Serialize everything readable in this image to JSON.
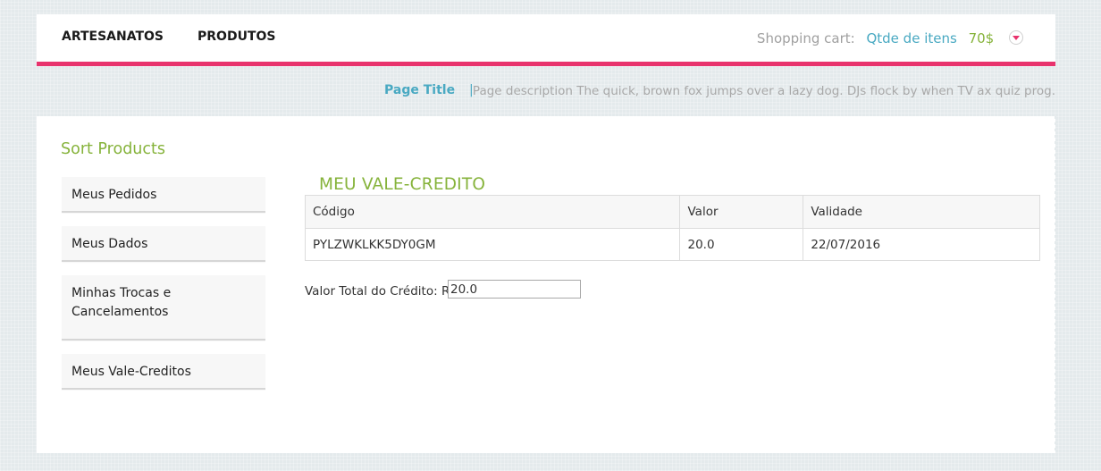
{
  "nav": {
    "items": [
      "ARTESANATOS",
      "PRODUTOS"
    ]
  },
  "cart": {
    "label": "Shopping cart:",
    "items_link": "Qtde de itens",
    "price": "70$",
    "toggle_icon": "chevron-down-icon"
  },
  "header": {
    "page_title": "Page Title",
    "separator": "|",
    "description": "Page description The quick, brown fox jumps over a lazy dog. DJs flock by when TV ax quiz prog."
  },
  "sidebar": {
    "title": "Sort Products",
    "items": [
      {
        "label": "Meus Pedidos"
      },
      {
        "label": "Meus Dados"
      },
      {
        "label": "Minhas Trocas e Cancelamentos"
      },
      {
        "label": "Meus Vale-Creditos"
      }
    ]
  },
  "main": {
    "title": "MEU VALE-CREDITO",
    "table": {
      "headers": [
        "Código",
        "Valor",
        "Validade"
      ],
      "rows": [
        [
          "PYLZWKLKK5DY0GM",
          "20.0",
          "22/07/2016"
        ]
      ]
    },
    "total_label": "Valor Total do Crédito: R$",
    "total_value": "20.0"
  },
  "colors": {
    "accent_pink": "#e8336d",
    "green": "#86b33b",
    "blue": "#49a9c2"
  }
}
